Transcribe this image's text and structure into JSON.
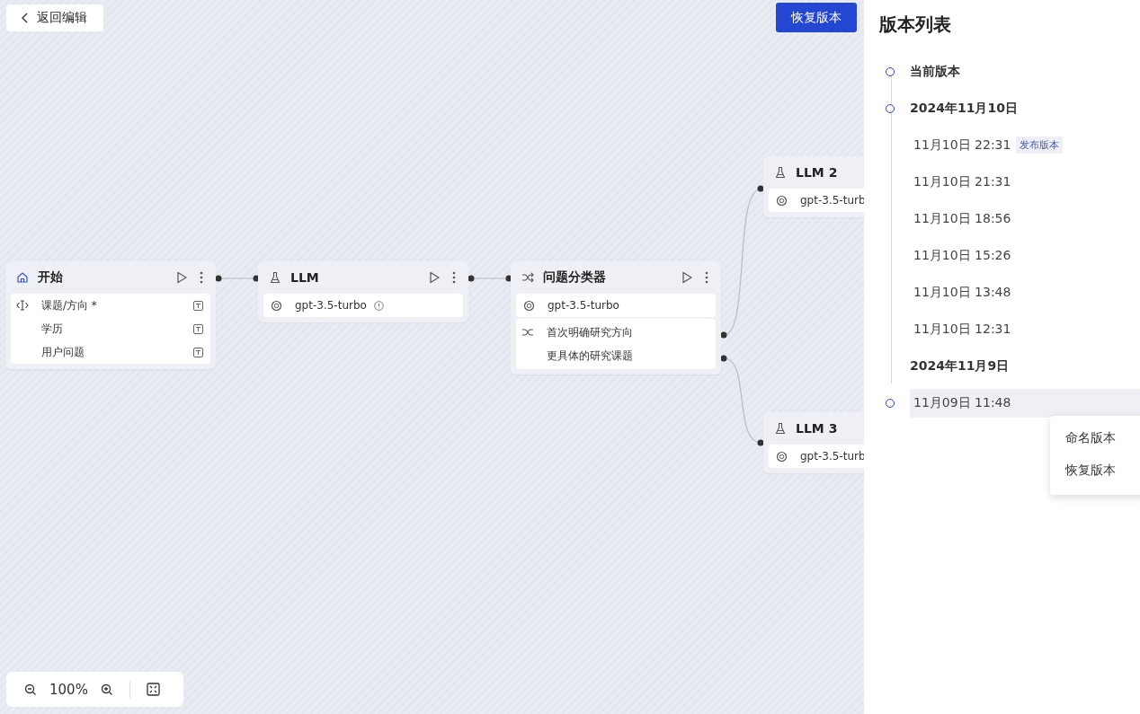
{
  "back_button": {
    "label": "返回编辑"
  },
  "restore_button": {
    "label": "恢复版本"
  },
  "nodes": [
    {
      "kind": "start",
      "title": "开始",
      "inputs": [
        "课题/方向 *",
        "学历",
        "用户问题"
      ]
    },
    {
      "kind": "llm",
      "title": "LLM",
      "model": "gpt-3.5-turbo",
      "info": true
    },
    {
      "kind": "classifier",
      "title": "问题分类器",
      "model": "gpt-3.5-turbo",
      "info": false,
      "classes": [
        "首次明确研究方向",
        "更具体的研究课题"
      ]
    },
    {
      "kind": "llm",
      "title": "LLM 2",
      "model": "gpt-3.5-turb",
      "info": false
    },
    {
      "kind": "llm",
      "title": "LLM 3",
      "model": "gpt-3.5-turb",
      "info": false
    }
  ],
  "zoom_bar": {
    "zoom": "100%"
  },
  "version_panel": {
    "title": "版本列表",
    "items": [
      {
        "kind": "current",
        "label": "当前版本",
        "dot": true,
        "selected": false
      },
      {
        "kind": "date",
        "label": "2024年11月10日",
        "dot": true,
        "selected": false
      },
      {
        "kind": "version",
        "label": "11月10日 22:31",
        "tag": "发布版本",
        "dot": false,
        "selected": false
      },
      {
        "kind": "version",
        "label": "11月10日 21:31",
        "dot": false,
        "selected": false
      },
      {
        "kind": "version",
        "label": "11月10日 18:56",
        "dot": false,
        "selected": false
      },
      {
        "kind": "version",
        "label": "11月10日 15:26",
        "dot": false,
        "selected": false
      },
      {
        "kind": "version",
        "label": "11月10日 13:48",
        "dot": false,
        "selected": false
      },
      {
        "kind": "version",
        "label": "11月10日 12:31",
        "dot": false,
        "selected": false
      },
      {
        "kind": "date",
        "label": "2024年11月9日",
        "dot": false,
        "selected": false
      },
      {
        "kind": "version",
        "label": "11月09日 11:48",
        "dot": true,
        "selected": true
      }
    ],
    "menu": [
      "命名版本",
      "恢复版本"
    ]
  }
}
